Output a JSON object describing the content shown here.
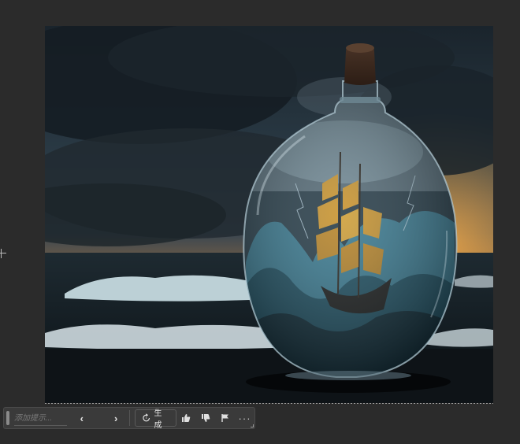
{
  "canvas": {
    "image_description_name": "ship-in-bottle-artwork"
  },
  "taskbar": {
    "prompt_placeholder": "添加提示...",
    "prev_label": "‹",
    "next_label": "›",
    "generate_label": "生成",
    "more_label": "···",
    "icons": {
      "generate": "refresh-sparkle-icon",
      "like": "thumbs-up-icon",
      "dislike": "thumbs-down-icon",
      "flag": "flag-icon",
      "more": "more-icon"
    }
  },
  "colors": {
    "taskbar_bg": "#3a3a3a",
    "canvas_bg": "#2b2b2b",
    "sky_glow": "#e89a3c",
    "sail": "#d99a2a",
    "wave": "#3e7f95"
  }
}
